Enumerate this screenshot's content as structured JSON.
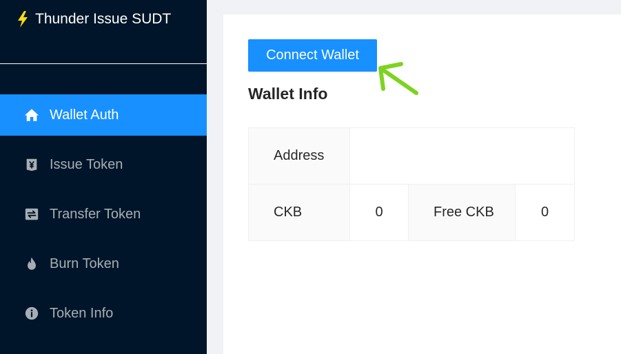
{
  "app": {
    "title": "Thunder Issue SUDT",
    "title_icon": "lightning-bolt-icon",
    "accent_color": "#1890ff",
    "bolt_color": "#fadb14",
    "sidebar_color": "#001529",
    "annotation_color": "#7ed321"
  },
  "sidebar": {
    "items": [
      {
        "label": "Wallet Auth",
        "icon": "home-icon",
        "active": true
      },
      {
        "label": "Issue Token",
        "icon": "yen-icon",
        "active": false
      },
      {
        "label": "Transfer Token",
        "icon": "swap-icon",
        "active": false
      },
      {
        "label": "Burn Token",
        "icon": "fire-icon",
        "active": false
      },
      {
        "label": "Token Info",
        "icon": "info-icon",
        "active": false
      }
    ]
  },
  "main": {
    "connect_button_label": "Connect Wallet",
    "section_title": "Wallet Info",
    "annotation": "arrow-icon",
    "wallet_info": {
      "address_label": "Address",
      "address_value": "",
      "ckb_label": "CKB",
      "ckb_value": "0",
      "free_ckb_label": "Free CKB",
      "free_ckb_value": "0"
    }
  }
}
